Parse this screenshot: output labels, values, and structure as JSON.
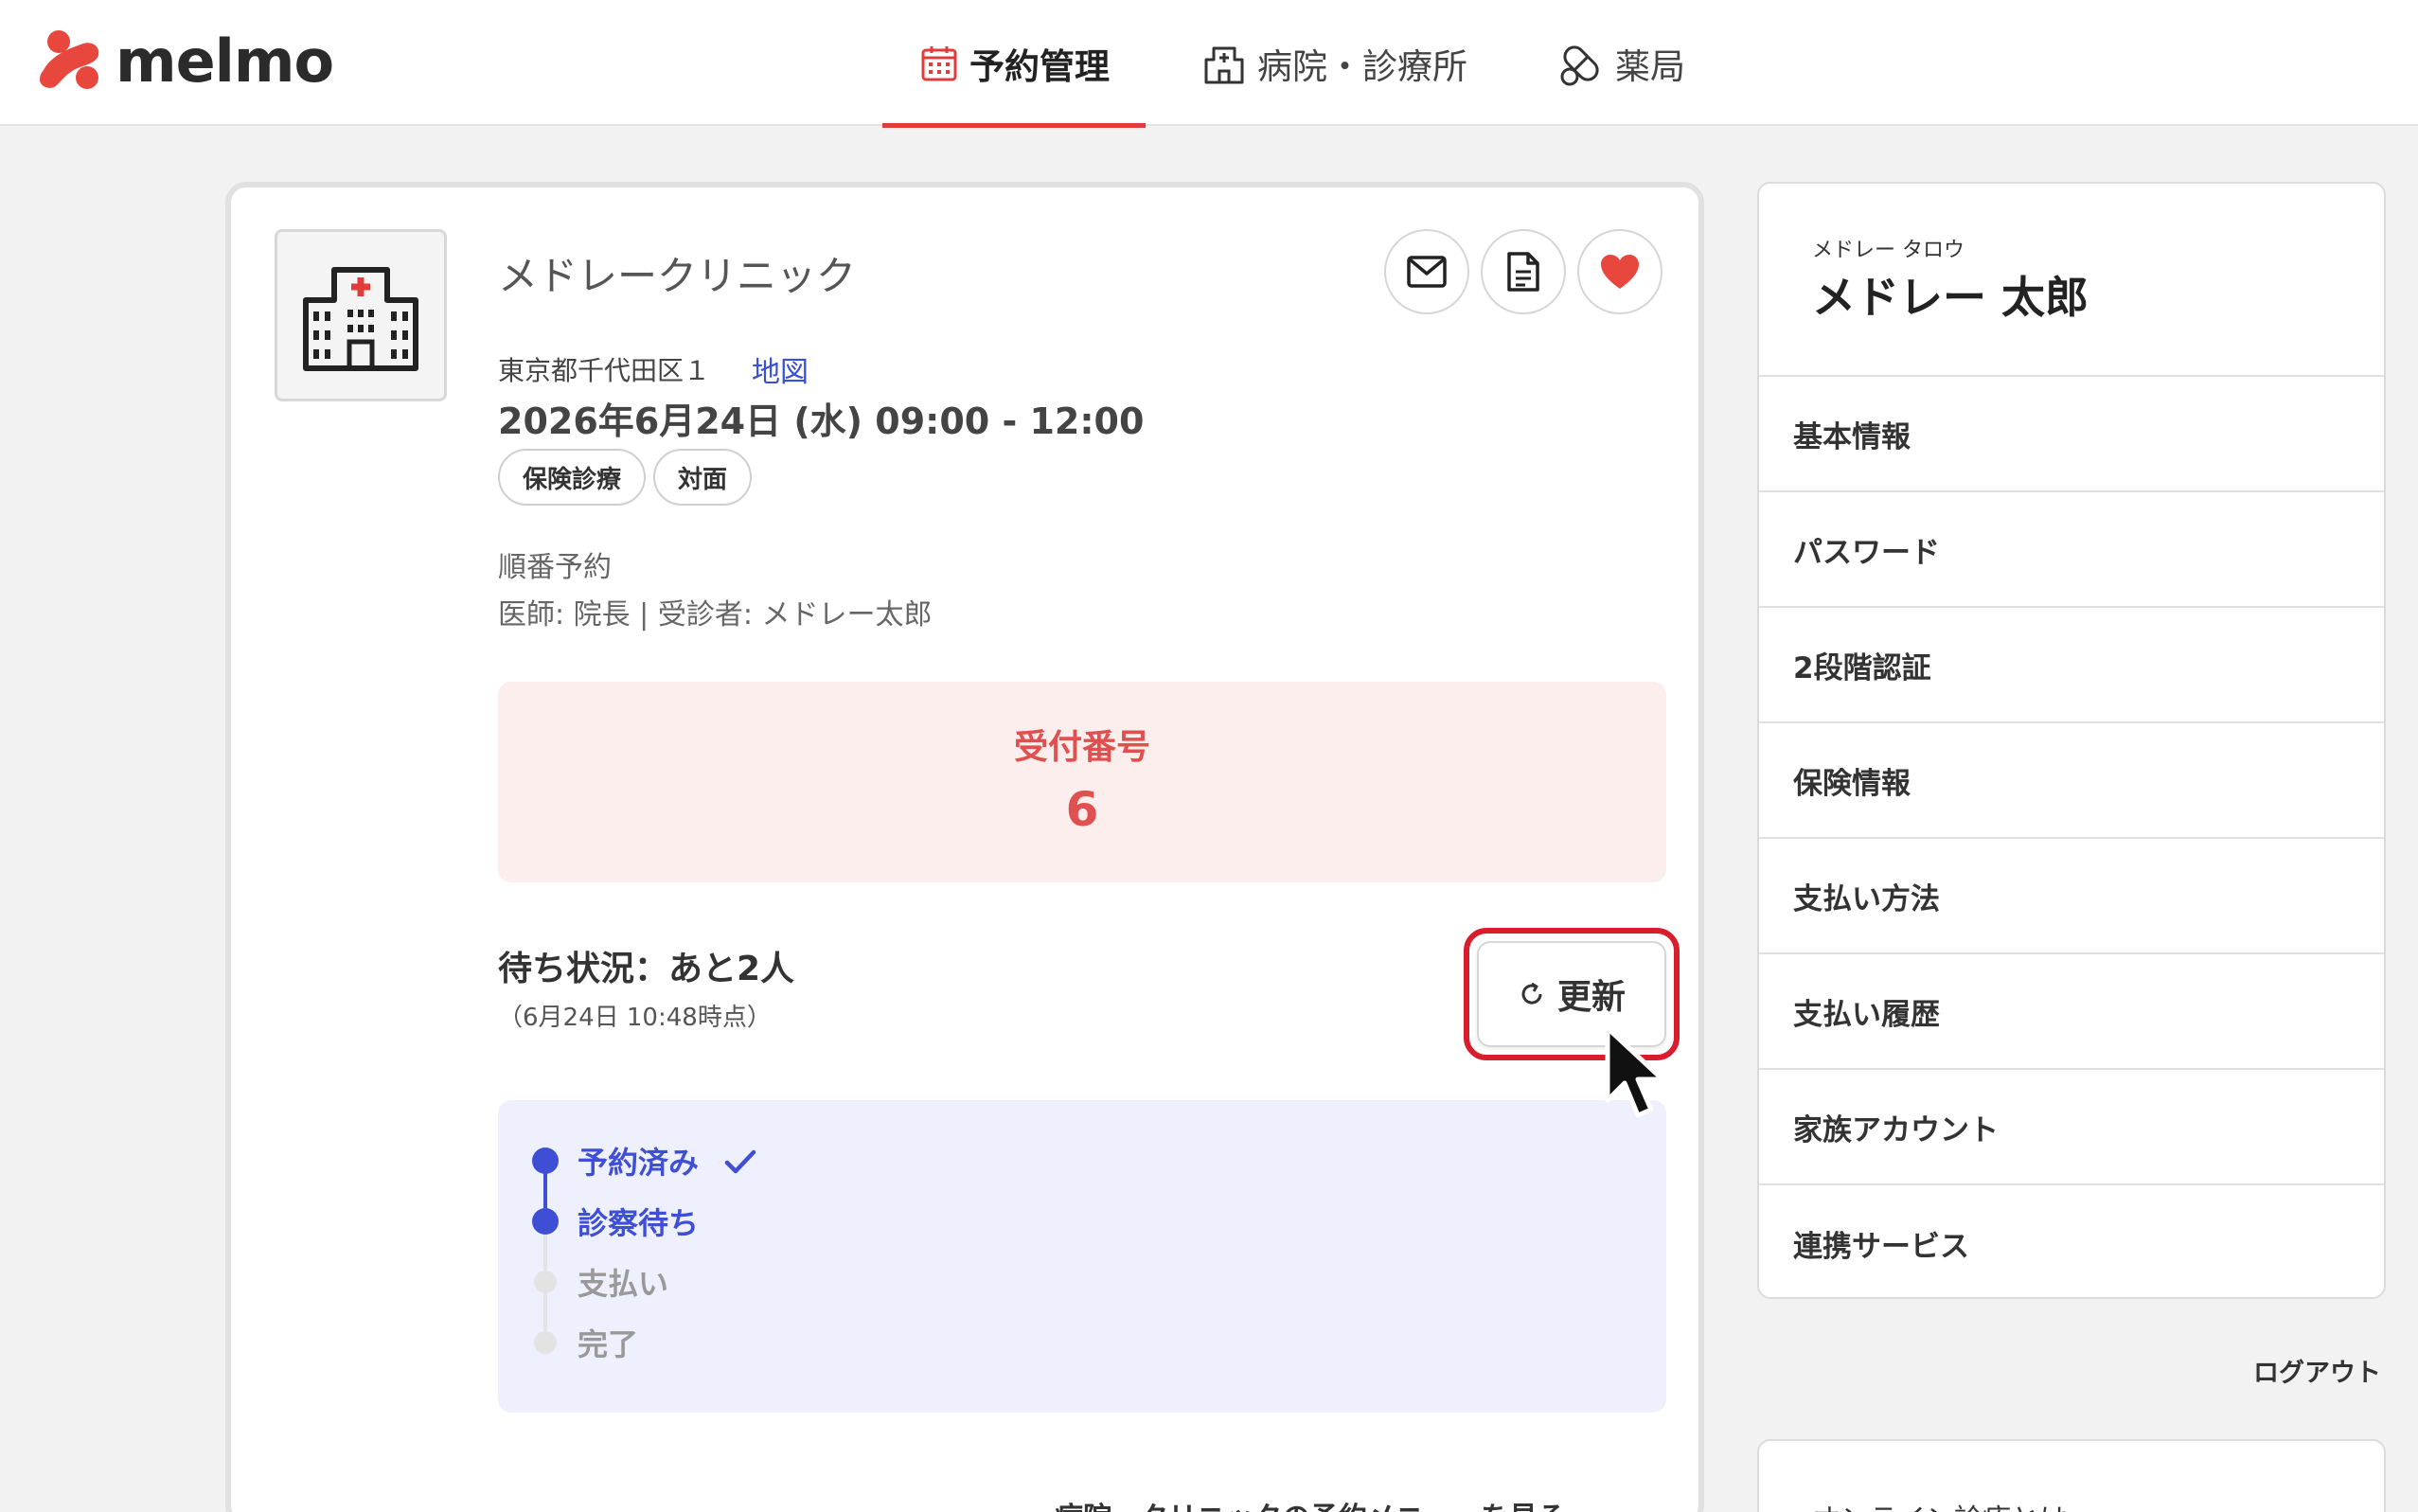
{
  "brand": {
    "name": "melmo",
    "color": "#e8473d"
  },
  "nav": {
    "items": [
      {
        "label": "予約管理",
        "icon": "calendar-icon",
        "active": true
      },
      {
        "label": "病院・診療所",
        "icon": "hospital-icon",
        "active": false
      },
      {
        "label": "薬局",
        "icon": "pill-icon",
        "active": false
      }
    ]
  },
  "reservation": {
    "clinic_name": "メドレークリニック",
    "address": "東京都千代田区１",
    "map_label": "地図",
    "datetime": "2026年6月24日 (水) 09:00 - 12:00",
    "tags": [
      "保険診療",
      "対面"
    ],
    "type": "順番予約",
    "doctor_patient": "医師: 院長 | 受診者: メドレー太郎",
    "ticket_label": "受付番号",
    "ticket_number": "6",
    "wait_status": "待ち状況：あと2人",
    "wait_time": "（6月24日 10:48時点）",
    "refresh_label": "更新",
    "steps": [
      {
        "label": "予約済み",
        "done": true,
        "check": true
      },
      {
        "label": "診察待ち",
        "done": true,
        "check": false
      },
      {
        "label": "支払い",
        "done": false
      },
      {
        "label": "完了",
        "done": false
      }
    ],
    "bottom_link": "病院・クリニックの予約メニューを見る"
  },
  "sidebar": {
    "user_kana": "メドレー タロウ",
    "user_name": "メドレー 太郎",
    "items": [
      "基本情報",
      "パスワード",
      "2段階認証",
      "保険情報",
      "支払い方法",
      "支払い履歴",
      "家族アカウント",
      "連携サービス"
    ],
    "logout_label": "ログアウト",
    "next_card_title": "オンライン診療とは"
  },
  "colors": {
    "accent_red": "#e03c3c",
    "progress_blue": "#3e4fd6",
    "ticket_bg": "#fbeeec",
    "progress_bg": "#eff0fd",
    "highlight": "#d81e2c"
  }
}
